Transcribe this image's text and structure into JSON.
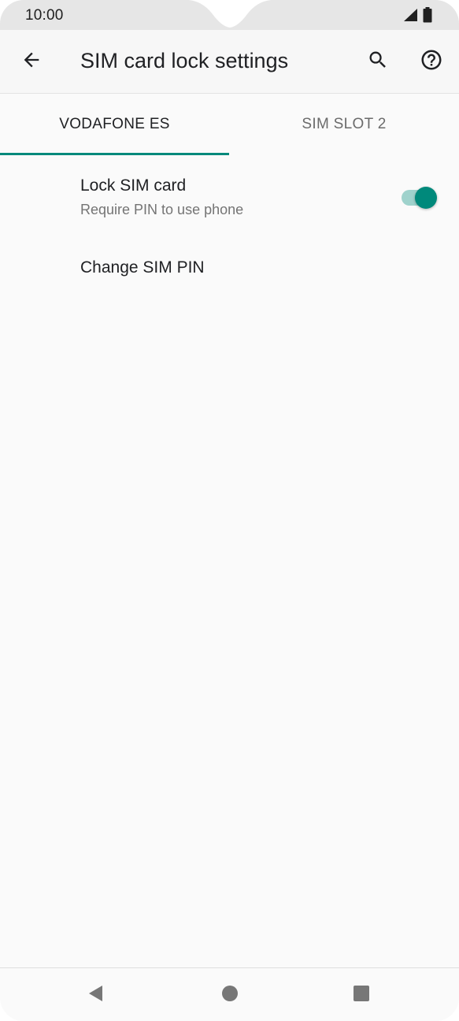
{
  "status_bar": {
    "time": "10:00",
    "signal_icon": "signal-icon",
    "battery_icon": "battery-icon"
  },
  "app_bar": {
    "title": "SIM card lock settings",
    "back_icon": "arrow-back-icon",
    "search_icon": "search-icon",
    "help_icon": "help-circle-icon"
  },
  "tabs": [
    {
      "label": "VODAFONE ES",
      "selected": true
    },
    {
      "label": "SIM SLOT 2",
      "selected": false
    }
  ],
  "settings": {
    "lock_sim": {
      "title": "Lock SIM card",
      "subtitle": "Require PIN to use phone",
      "enabled": true
    },
    "change_pin": {
      "title": "Change SIM PIN"
    }
  },
  "nav_bar": {
    "back_icon": "nav-back-triangle-icon",
    "home_icon": "nav-home-circle-icon",
    "recents_icon": "nav-recents-square-icon"
  },
  "colors": {
    "accent": "#00897b",
    "accent_light": "#9fd2cc",
    "status_bar_bg": "#e6e6e6",
    "app_bar_bg": "#f7f7f7",
    "background": "#fafafa"
  }
}
